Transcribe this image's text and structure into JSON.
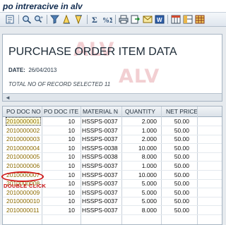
{
  "window": {
    "title": "po intreracive in alv"
  },
  "toolbar": {
    "icons": [
      "details-icon",
      "find-icon",
      "find-next-icon",
      "filter-icon",
      "sort-ascending-icon",
      "sort-descending-icon",
      "total-icon",
      "subtotal-icon",
      "print-icon",
      "export-icon",
      "mail-icon",
      "word-icon",
      "layout-icon",
      "change-layout-icon",
      "grid-icon"
    ]
  },
  "header": {
    "title": "PURCHASE ORDER ITEM DATA",
    "date_label": "DATE:",
    "date_value": "26/04/2013",
    "total_text": "TOTAL NO OF RECORD SELECTED 11",
    "watermark": "ALV",
    "scroll_left": "◄"
  },
  "grid": {
    "columns": [
      "PO DOC NO",
      "PO DOC ITE",
      "MATERIAL N",
      "QUANTITY",
      "NET PRICE"
    ],
    "rows": [
      [
        "2010000001",
        "10",
        "HSSPS-0037",
        "2.000",
        "50.00"
      ],
      [
        "2010000002",
        "10",
        "HSSPS-0037",
        "1.000",
        "50.00"
      ],
      [
        "2010000003",
        "10",
        "HSSPS-0037",
        "2.000",
        "50.00"
      ],
      [
        "2010000004",
        "10",
        "HSSPS-0038",
        "10.000",
        "50.00"
      ],
      [
        "2010000005",
        "10",
        "HSSPS-0038",
        "8.000",
        "50.00"
      ],
      [
        "2010000006",
        "10",
        "HSSPS-0037",
        "1.000",
        "50.00"
      ],
      [
        "2010000007",
        "10",
        "HSSPS-0037",
        "10.000",
        "50.00"
      ],
      [
        "2010000008",
        "10",
        "HSSPS-0037",
        "5.000",
        "50.00"
      ],
      [
        "2010000009",
        "10",
        "HSSPS-0037",
        "5.000",
        "50.00"
      ],
      [
        "2010000010",
        "10",
        "HSSPS-0037",
        "5.000",
        "50.00"
      ],
      [
        "2010000011",
        "10",
        "HSSPS-0037",
        "8.000",
        "50.00"
      ]
    ]
  },
  "annotation": {
    "text": "DOUBLE CLICK",
    "color": "#d11717"
  }
}
